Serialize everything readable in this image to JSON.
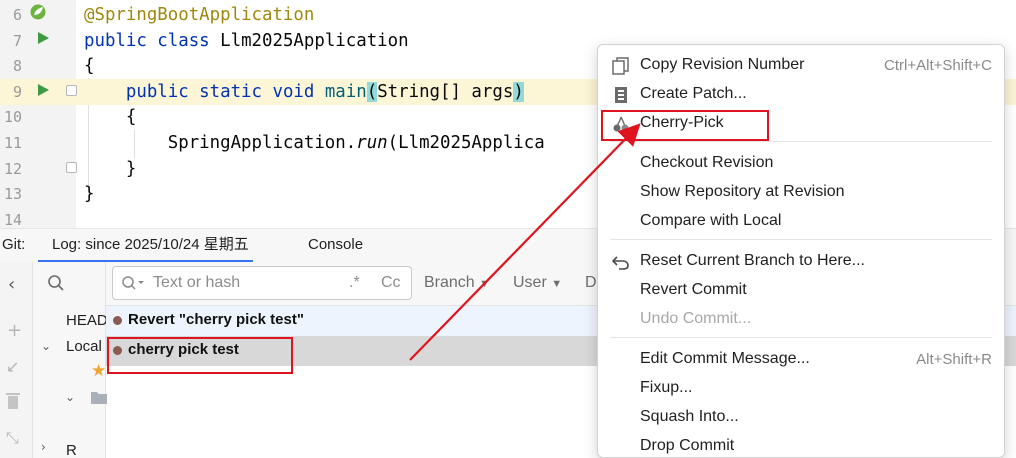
{
  "editor": {
    "lines": [
      {
        "num": "6",
        "tokens": [
          {
            "t": "@SpringBootApplication",
            "c": "ann"
          }
        ]
      },
      {
        "num": "7",
        "tokens": [
          {
            "t": "public class ",
            "c": "kw"
          },
          {
            "t": "Llm2025Application",
            "c": ""
          }
        ]
      },
      {
        "num": "8",
        "tokens": [
          {
            "t": "{",
            "c": ""
          }
        ]
      },
      {
        "num": "9",
        "tokens": [
          {
            "t": "    ",
            "c": ""
          },
          {
            "t": "public static void ",
            "c": "kw"
          },
          {
            "t": "main",
            "c": "fn"
          },
          {
            "t": "(",
            "c": "paren-hl"
          },
          {
            "t": "String[] args",
            "c": ""
          },
          {
            "t": ")",
            "c": "paren-hl"
          }
        ]
      },
      {
        "num": "10",
        "tokens": [
          {
            "t": "    {",
            "c": ""
          }
        ]
      },
      {
        "num": "11",
        "tokens": [
          {
            "t": "        SpringApplication.",
            "c": ""
          },
          {
            "t": "run",
            "c": "it"
          },
          {
            "t": "(Llm2025Applica",
            "c": ""
          }
        ]
      },
      {
        "num": "12",
        "tokens": [
          {
            "t": "    }",
            "c": ""
          }
        ]
      },
      {
        "num": "13",
        "tokens": [
          {
            "t": "}",
            "c": ""
          }
        ]
      },
      {
        "num": "14",
        "tokens": [
          {
            "t": "",
            "c": ""
          }
        ]
      }
    ]
  },
  "tool_window": {
    "git_label": "Git:",
    "tab_log": "Log: since 2025/10/24 星期五",
    "tab_console": "Console"
  },
  "log": {
    "search_placeholder": "Text or hash",
    "regex_label": ".*",
    "case_label": "Cc",
    "filter_branch": "Branch",
    "filter_user": "User",
    "filter_date": "D",
    "branch_head": "HEAD",
    "branch_local": "Local",
    "branch_remote": "R",
    "commits": [
      {
        "message": "Revert \"cherry pick test\""
      },
      {
        "message": "cherry pick test"
      }
    ]
  },
  "context_menu": {
    "items": [
      {
        "label": "Copy Revision Number",
        "shortcut": "Ctrl+Alt+Shift+C",
        "icon": "copy-icon",
        "disabled": false
      },
      {
        "label": "Create Patch...",
        "shortcut": "",
        "icon": "patch-icon",
        "disabled": false
      },
      {
        "label": "Cherry-Pick",
        "shortcut": "",
        "icon": "cherry-icon",
        "disabled": false
      },
      {
        "label": "Checkout Revision",
        "shortcut": "",
        "icon": "",
        "disabled": false
      },
      {
        "label": "Show Repository at Revision",
        "shortcut": "",
        "icon": "",
        "disabled": false
      },
      {
        "label": "Compare with Local",
        "shortcut": "",
        "icon": "",
        "disabled": false
      },
      {
        "label": "Reset Current Branch to Here...",
        "shortcut": "",
        "icon": "undo-icon",
        "disabled": false
      },
      {
        "label": "Revert Commit",
        "shortcut": "",
        "icon": "",
        "disabled": false
      },
      {
        "label": "Undo Commit...",
        "shortcut": "",
        "icon": "",
        "disabled": true
      },
      {
        "label": "Edit Commit Message...",
        "shortcut": "Alt+Shift+R",
        "icon": "",
        "disabled": false
      },
      {
        "label": "Fixup...",
        "shortcut": "",
        "icon": "",
        "disabled": false
      },
      {
        "label": "Squash Into...",
        "shortcut": "",
        "icon": "",
        "disabled": false
      },
      {
        "label": "Drop Commit",
        "shortcut": "",
        "icon": "",
        "disabled": false
      }
    ]
  },
  "colors": {
    "annotation_red": "#e0141e",
    "accent_blue": "#3574f0",
    "run_green": "#3f9a44"
  }
}
